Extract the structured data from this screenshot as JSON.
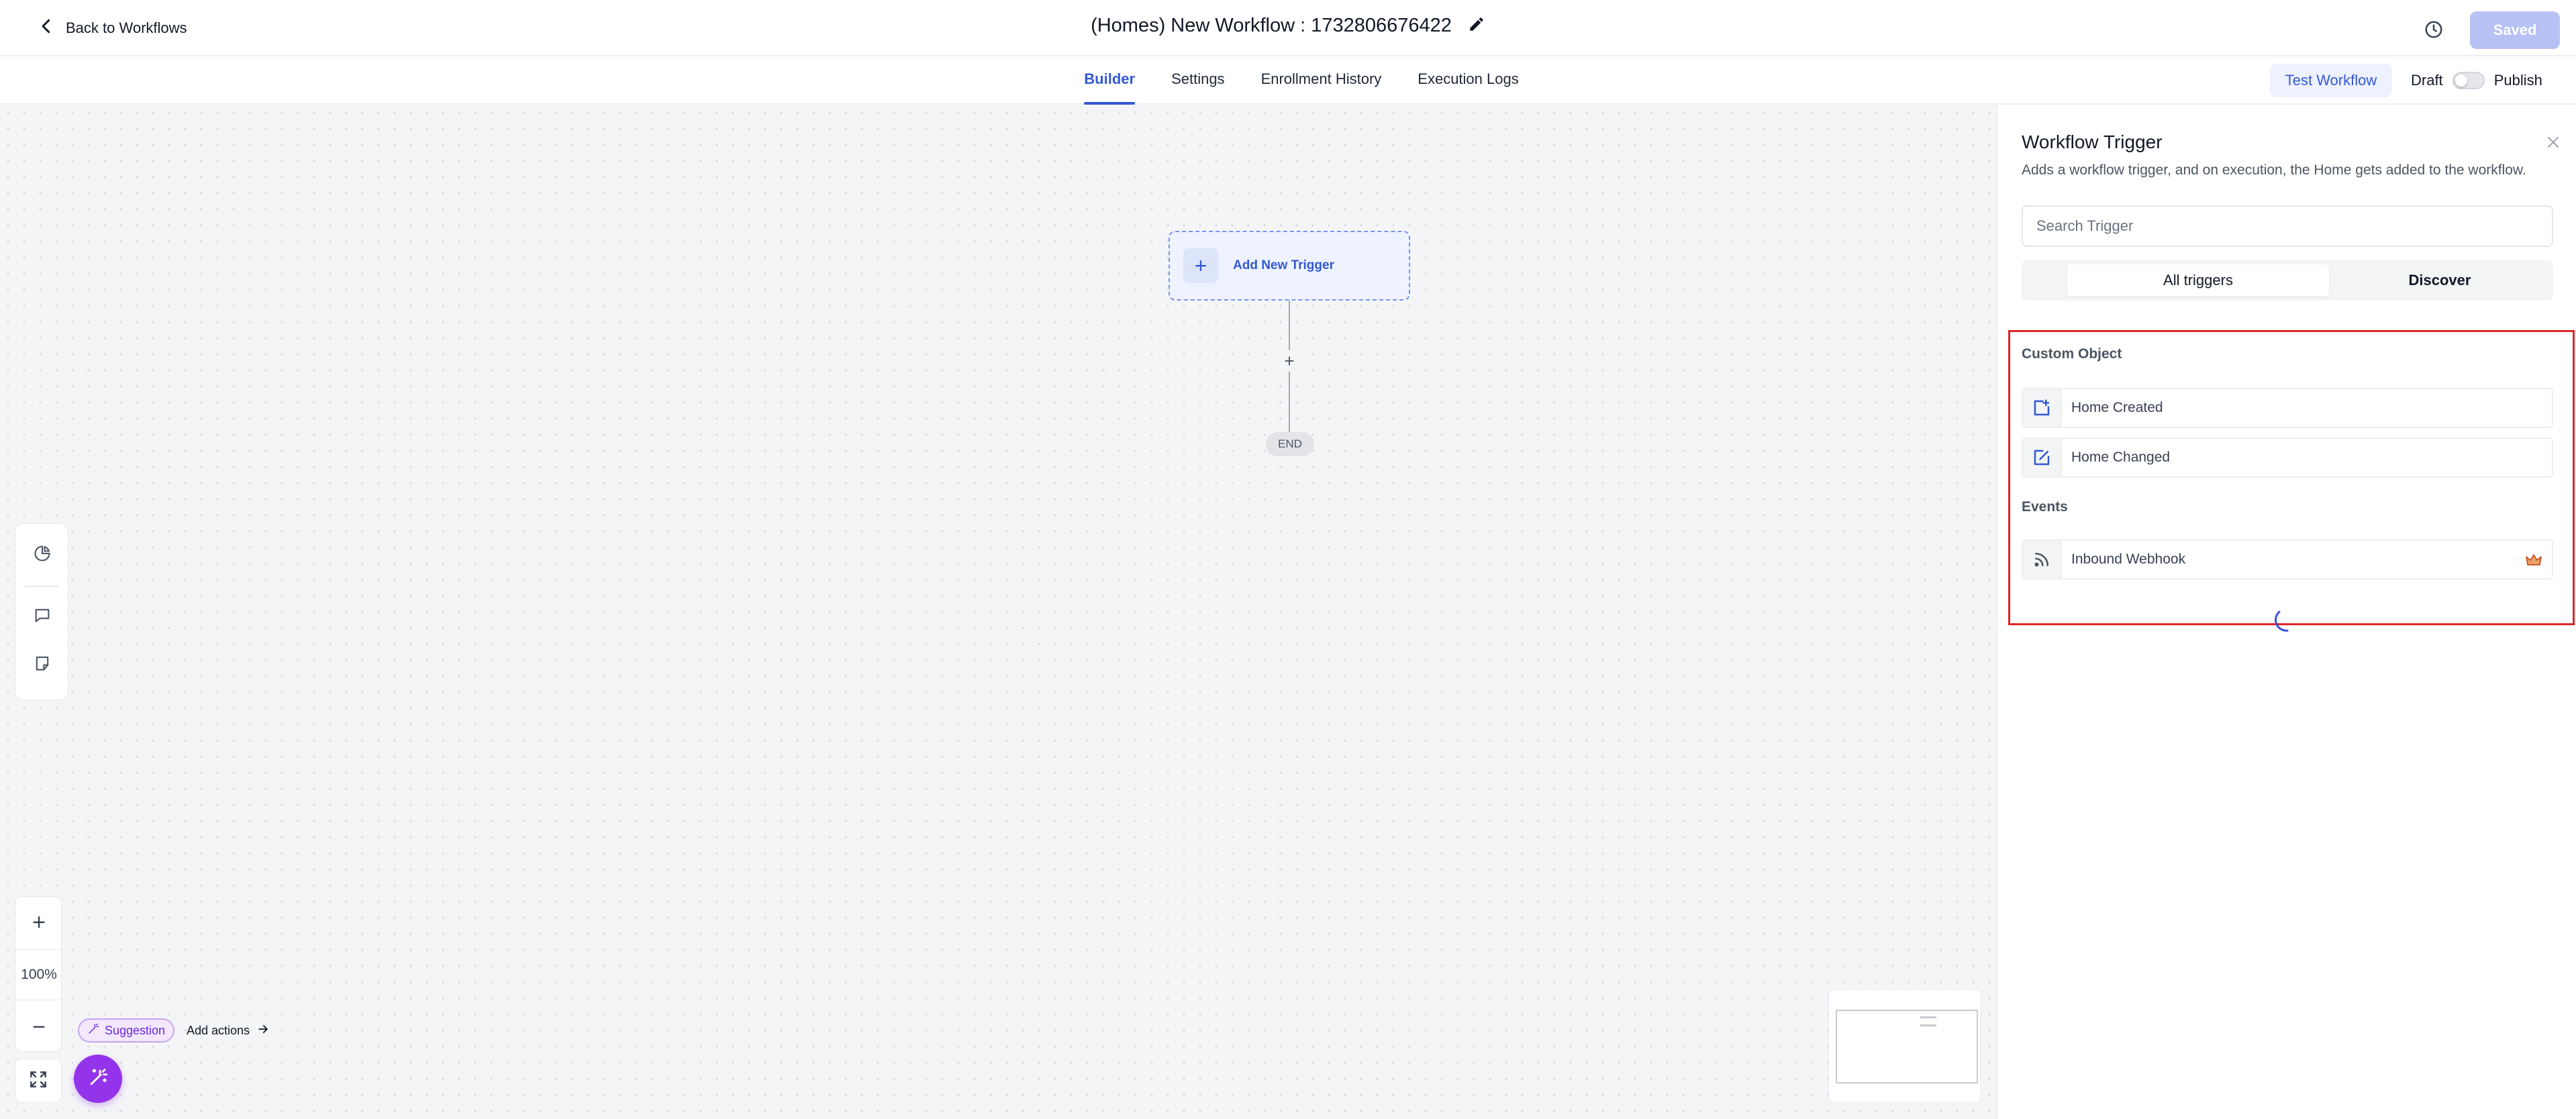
{
  "header": {
    "back_label": "Back to Workflows",
    "title": "(Homes) New Workflow : 1732806676422",
    "saved_label": "Saved"
  },
  "tabs": [
    {
      "label": "Builder",
      "active": true
    },
    {
      "label": "Settings",
      "active": false
    },
    {
      "label": "Enrollment History",
      "active": false
    },
    {
      "label": "Execution Logs",
      "active": false
    }
  ],
  "actions": {
    "test_label": "Test Workflow",
    "draft_label": "Draft",
    "publish_label": "Publish",
    "publish_enabled": false
  },
  "canvas": {
    "trigger_label": "Add New Trigger",
    "connector_plus": "+",
    "end_label": "END",
    "zoom_in": "+",
    "zoom_level": "100%",
    "zoom_out": "−",
    "suggestion_label": "Suggestion",
    "add_actions_label": "Add actions"
  },
  "panel": {
    "title": "Workflow Trigger",
    "description": "Adds a workflow trigger, and on execution, the Home gets added to the workflow.",
    "search_placeholder": "Search Trigger",
    "segments": [
      "All triggers",
      "Discover"
    ],
    "groups": [
      {
        "name": "Custom Object",
        "items": [
          {
            "label": "Home Created",
            "icon": "add-square-icon"
          },
          {
            "label": "Home Changed",
            "icon": "edit-square-icon"
          }
        ]
      },
      {
        "name": "Events",
        "items": [
          {
            "label": "Inbound Webhook",
            "icon": "rss-icon",
            "premium": true
          }
        ]
      }
    ]
  },
  "colors": {
    "accent": "#3358d4",
    "highlight": "#dc2626",
    "magic": "#9333ea"
  }
}
